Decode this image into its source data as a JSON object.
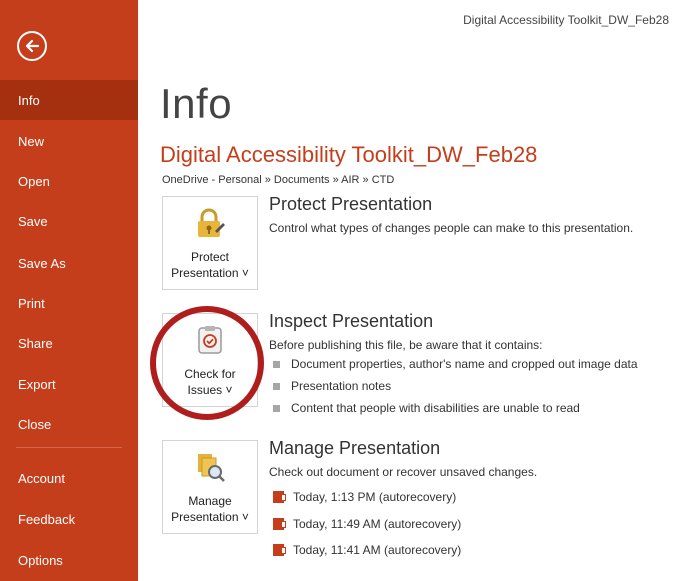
{
  "window": {
    "title": "Digital Accessibility Toolkit_DW_Feb28"
  },
  "sidebar": {
    "back_icon": "arrow-left-circle-icon",
    "items": [
      {
        "label": "Info",
        "active": true
      },
      {
        "label": "New"
      },
      {
        "label": "Open"
      },
      {
        "label": "Save"
      },
      {
        "label": "Save As"
      },
      {
        "label": "Print"
      },
      {
        "label": "Share"
      },
      {
        "label": "Export"
      },
      {
        "label": "Close"
      },
      {
        "label": "Account"
      },
      {
        "label": "Feedback"
      },
      {
        "label": "Options"
      }
    ]
  },
  "main": {
    "page_title": "Info",
    "doc_title": "Digital Accessibility Toolkit_DW_Feb28",
    "breadcrumb": "OneDrive - Personal » Documents » AIR » CTD",
    "protect": {
      "tile_line1": "Protect",
      "tile_line2": "Presentation ˅",
      "icon": "lock-key-icon",
      "heading": "Protect Presentation",
      "description": "Control what types of changes people can make to this presentation."
    },
    "inspect": {
      "tile_line1": "Check for",
      "tile_line2": "Issues ˅",
      "icon": "inspect-checklist-icon",
      "heading": "Inspect Presentation",
      "description": "Before publishing this file, be aware that it contains:",
      "bullets": [
        "Document properties, author's name and cropped out image data",
        "Presentation notes",
        "Content that people with disabilities are unable to read"
      ]
    },
    "manage": {
      "tile_line1": "Manage",
      "tile_line2": "Presentation ˅",
      "icon": "manage-documents-icon",
      "heading": "Manage Presentation",
      "description": "Check out document or recover unsaved changes.",
      "versions": [
        "Today, 1:13 PM (autorecovery)",
        "Today, 11:49 AM (autorecovery)",
        "Today, 11:41 AM (autorecovery)"
      ]
    }
  },
  "colors": {
    "accent": "#c43e1c",
    "active": "#a5300f",
    "highlight_ring": "#b01d1d"
  }
}
